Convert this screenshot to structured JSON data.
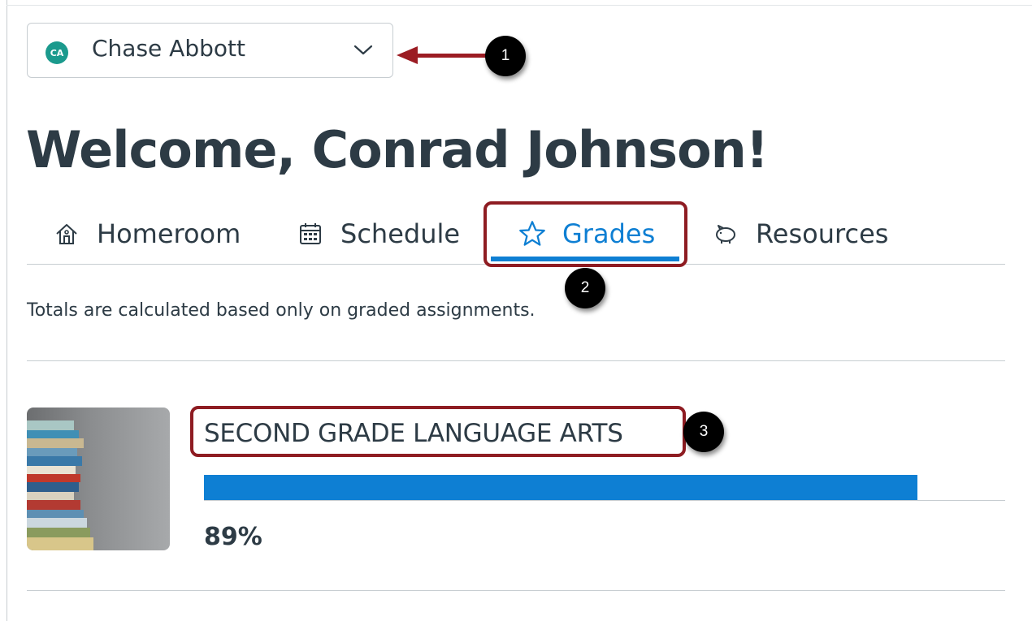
{
  "observer": {
    "initials": "CA",
    "name": "Chase Abbott",
    "avatar_color": "#1b9a8d"
  },
  "welcome": "Welcome, Conrad Johnson!",
  "tabs": [
    {
      "label": "Homeroom",
      "icon": "home-icon"
    },
    {
      "label": "Schedule",
      "icon": "calendar-icon"
    },
    {
      "label": "Grades",
      "icon": "star-icon",
      "active": true
    },
    {
      "label": "Resources",
      "icon": "piggy-bank-icon"
    }
  ],
  "note": "Totals are calculated based only on graded assignments.",
  "course": {
    "title": "SECOND GRADE LANGUAGE ARTS",
    "grade": "89%",
    "progress": 0.89
  },
  "callouts": [
    "1",
    "2",
    "3"
  ],
  "colors": {
    "accent": "#0e7fd3",
    "annotation": "#8e1c22",
    "text": "#2d3b45"
  }
}
